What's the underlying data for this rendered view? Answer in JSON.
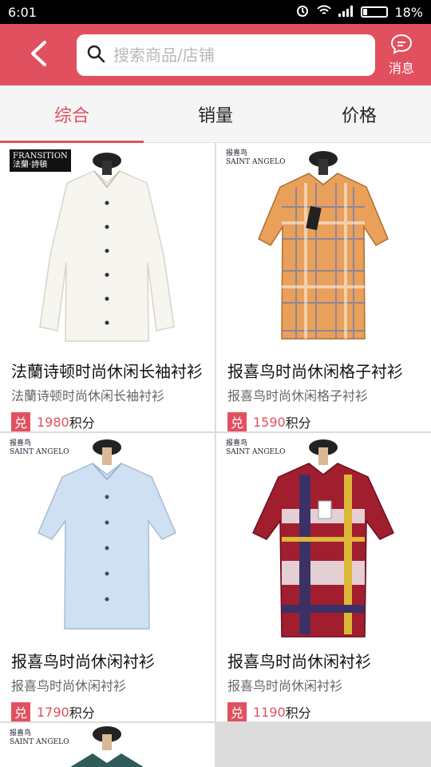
{
  "status": {
    "time": "6:01",
    "battery": "18%",
    "battery_level": 0.18
  },
  "header": {
    "search_placeholder": "搜索商品/店铺",
    "message_label": "消息"
  },
  "tabs": [
    {
      "label": "综合"
    },
    {
      "label": "销量"
    },
    {
      "label": "价格"
    }
  ],
  "products": [
    {
      "brand": "FRANSITION",
      "brand_sub": "法蘭·詩頓",
      "title": "法蘭诗顿时尚休闲长袖衬衫",
      "subtitle": "法蘭诗顿时尚休闲长袖衬衫",
      "badge": "兑",
      "points": "1980",
      "unit": "积分",
      "shirt_color": "#f7f5ef"
    },
    {
      "brand": "SAINT ANGELO",
      "brand_sub": "报喜鸟",
      "title": "报喜鸟时尚休闲格子衬衫",
      "subtitle": "报喜鸟时尚休闲格子衬衫",
      "badge": "兑",
      "points": "1590",
      "unit": "积分",
      "shirt_color": "#e8a05a"
    },
    {
      "brand": "SAINT ANGELO",
      "brand_sub": "报喜鸟",
      "title": "报喜鸟时尚休闲衬衫",
      "subtitle": "报喜鸟时尚休闲衬衫",
      "badge": "兑",
      "points": "1790",
      "unit": "积分",
      "shirt_color": "#cfe0f2"
    },
    {
      "brand": "SAINT ANGELO",
      "brand_sub": "报喜鸟",
      "title": "报喜鸟时尚休闲衬衫",
      "subtitle": "报喜鸟时尚休闲衬衫",
      "badge": "兑",
      "points": "1190",
      "unit": "积分",
      "shirt_color": "#a11e2e"
    },
    {
      "brand": "SAINT ANGELO",
      "brand_sub": "报喜鸟",
      "shirt_color": "#2f5b5a"
    }
  ]
}
